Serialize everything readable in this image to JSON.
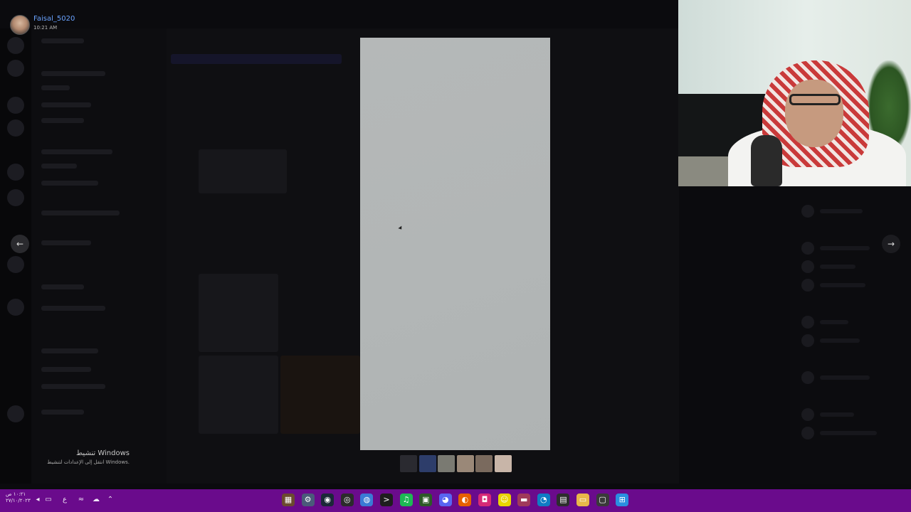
{
  "viewer": {
    "username": "Faisal_5020",
    "timestamp": "10:21 AM"
  },
  "navigation": {
    "prev_icon": "arrow-left-icon",
    "next_icon": "arrow-right-icon",
    "prev_glyph": "←",
    "next_glyph": "→"
  },
  "watermark": {
    "title": "تنشيط Windows",
    "subtitle": "انتقل إلى الإعدادات لتنشيط Windows."
  },
  "taskbar": {
    "clock_time": "١٠:٢١ ص",
    "clock_date": "٢٧/١٠/٢٠٢٣",
    "language": "ع",
    "tray_icons": [
      "volume-icon",
      "display-icon",
      "language-icon",
      "network-icon",
      "cloud-icon",
      "chevron-up-icon"
    ],
    "apps": [
      {
        "name": "app-1-icon",
        "color": "#6b4a2f",
        "glyph": "▦"
      },
      {
        "name": "settings-icon",
        "color": "#4a5a7a",
        "glyph": "⚙"
      },
      {
        "name": "steam-icon",
        "color": "#1b2838",
        "glyph": "◉"
      },
      {
        "name": "obs-icon",
        "color": "#2b2b2b",
        "glyph": "◎"
      },
      {
        "name": "chrome-icon",
        "color": "#3a7bd5",
        "glyph": "◍"
      },
      {
        "name": "terminal-icon",
        "color": "#1e1e1e",
        "glyph": ">"
      },
      {
        "name": "spotify-icon",
        "color": "#1db954",
        "glyph": "♫"
      },
      {
        "name": "app-8-icon",
        "color": "#2d5a27",
        "glyph": "▣"
      },
      {
        "name": "discord-icon",
        "color": "#5865f2",
        "glyph": "◕"
      },
      {
        "name": "firefox-icon",
        "color": "#e66000",
        "glyph": "◐"
      },
      {
        "name": "instagram-icon",
        "color": "#d62976",
        "glyph": "◘"
      },
      {
        "name": "snapchat-icon",
        "color": "#e8d500",
        "glyph": "☺"
      },
      {
        "name": "app-13-icon",
        "color": "#a03a5a",
        "glyph": "▬"
      },
      {
        "name": "edge-icon",
        "color": "#0f7cc4",
        "glyph": "◔"
      },
      {
        "name": "clapper-icon",
        "color": "#2d2d2d",
        "glyph": "▤"
      },
      {
        "name": "file-explorer-icon",
        "color": "#e8b84a",
        "glyph": "▭"
      },
      {
        "name": "app-17-icon",
        "color": "#3a3a3a",
        "glyph": "▢"
      },
      {
        "name": "windows-start-icon",
        "color": "#2a8fe0",
        "glyph": "⊞"
      }
    ]
  },
  "thumbnails": [
    {
      "name": "thumbnail-1",
      "color": "#2a2a30"
    },
    {
      "name": "thumbnail-2",
      "color": "#2d3d6a"
    },
    {
      "name": "thumbnail-3",
      "color": "#7a7a72"
    },
    {
      "name": "thumbnail-4",
      "color": "#9a8878"
    },
    {
      "name": "thumbnail-5",
      "color": "#7a6a5e"
    },
    {
      "name": "thumbnail-6",
      "color": "#c8b5a8"
    }
  ]
}
